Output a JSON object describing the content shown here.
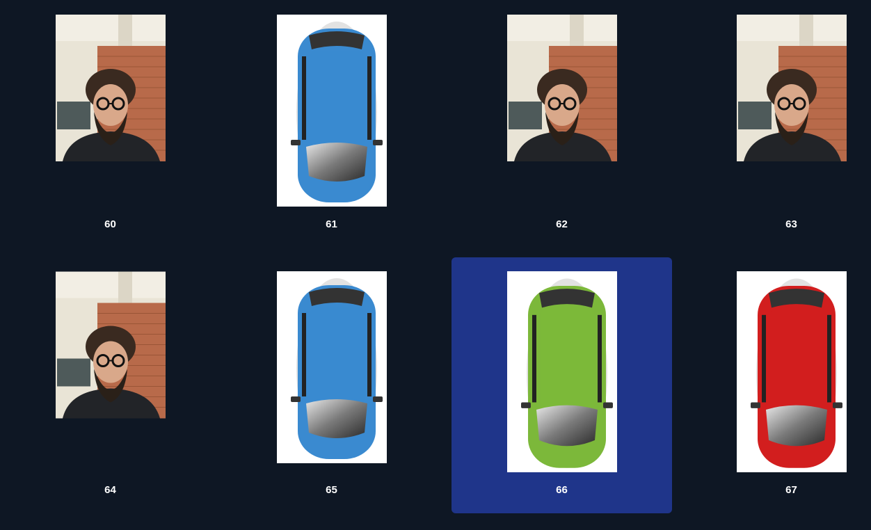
{
  "gallery": {
    "items": [
      {
        "label": "60",
        "kind": "photo-person",
        "selected": false
      },
      {
        "label": "61",
        "kind": "car-blue",
        "selected": false
      },
      {
        "label": "62",
        "kind": "photo-person",
        "selected": false
      },
      {
        "label": "63",
        "kind": "photo-person",
        "selected": false
      },
      {
        "label": "64",
        "kind": "photo-person",
        "selected": false
      },
      {
        "label": "65",
        "kind": "car-blue",
        "selected": false
      },
      {
        "label": "66",
        "kind": "car-green",
        "selected": true
      },
      {
        "label": "67",
        "kind": "car-red",
        "selected": false
      }
    ]
  },
  "colors": {
    "background": "#0e1724",
    "selection": "#1f358a",
    "label_text": "#ffffff",
    "car_blue": "#3a8ad0",
    "car_green": "#7cb83a",
    "car_red": "#d21e1e"
  }
}
